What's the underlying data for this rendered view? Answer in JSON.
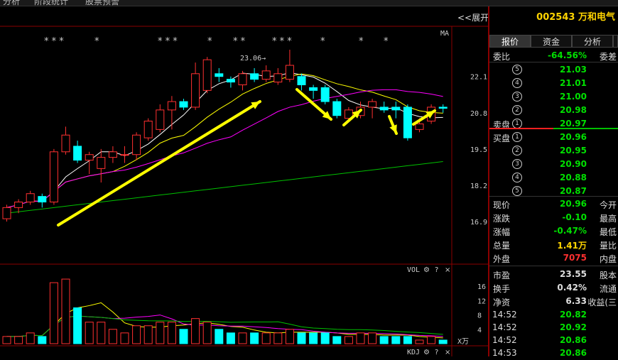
{
  "top_menu": [
    "分析",
    "阶段统计",
    "股票预警"
  ],
  "expand_label": "<<展开",
  "main_chart": {
    "ma_label": "MA",
    "star_groups": [
      "* * *",
      "*",
      "* * *",
      "*",
      "* *",
      "* * *",
      "*",
      "*",
      "*"
    ],
    "high_annotation": "23.06→",
    "price_ticks": [
      "22.1",
      "20.8",
      "19.5",
      "18.2",
      "16.9"
    ]
  },
  "volume_panel": {
    "label": "VOL",
    "ticks": [
      "16",
      "12",
      "8",
      "4"
    ],
    "unit": "X万"
  },
  "kdj_panel": {
    "label": "KDJ"
  },
  "stock": {
    "code": "002543",
    "name": "万和电气"
  },
  "tabs": [
    "报价",
    "资金",
    "分析"
  ],
  "quote": {
    "weibi_label": "委比",
    "weibi_value": "-64.56%",
    "weicha_label": "委差",
    "sell_label": "卖盘",
    "buy_label": "买盘",
    "sell_levels": [
      {
        "n": "5",
        "price": "21.03"
      },
      {
        "n": "4",
        "price": "21.01"
      },
      {
        "n": "3",
        "price": "21.00"
      },
      {
        "n": "2",
        "price": "20.98"
      },
      {
        "n": "1",
        "price": "20.97"
      }
    ],
    "buy_levels": [
      {
        "n": "1",
        "price": "20.96"
      },
      {
        "n": "2",
        "price": "20.95"
      },
      {
        "n": "3",
        "price": "20.90"
      },
      {
        "n": "4",
        "price": "20.88"
      },
      {
        "n": "5",
        "price": "20.87"
      }
    ]
  },
  "stats": [
    {
      "label": "现价",
      "value": "20.96",
      "label2": "今开",
      "color": "#00e000"
    },
    {
      "label": "涨跌",
      "value": "-0.10",
      "label2": "最高",
      "color": "#00e000"
    },
    {
      "label": "涨幅",
      "value": "-0.47%",
      "label2": "最低",
      "color": "#00e000"
    },
    {
      "label": "总量",
      "value": "1.41万",
      "label2": "量比",
      "color": "#ffd400"
    },
    {
      "label": "外盘",
      "value": "7075",
      "label2": "内盘",
      "color": "#ff3030"
    },
    {
      "label": "市盈",
      "value": "23.55",
      "label2": "股本",
      "color": "#dddddd"
    },
    {
      "label": "换手",
      "value": "0.42%",
      "label2": "流通",
      "color": "#dddddd"
    },
    {
      "label": "净资",
      "value": "6.33",
      "label2": "收益(三",
      "color": "#dddddd"
    }
  ],
  "ticks": [
    {
      "time": "14:52",
      "price": "20.82"
    },
    {
      "time": "14:52",
      "price": "20.92"
    },
    {
      "time": "14:52",
      "price": "20.86"
    },
    {
      "time": "14:53",
      "price": "20.86"
    }
  ],
  "colors": {
    "up": "#ff3030",
    "down": "#00ffff",
    "ma5": "#ffffff",
    "ma10": "#ffff00",
    "ma20": "#ff00ff",
    "ma60": "#00c000",
    "arrow": "#ffff00"
  },
  "chart_data": {
    "type": "candlestick",
    "y_range": [
      16.9,
      23.06
    ],
    "candles": [
      {
        "o": 17.0,
        "c": 17.4,
        "h": 17.5,
        "l": 16.9,
        "v": 2
      },
      {
        "o": 17.4,
        "c": 17.6,
        "h": 17.7,
        "l": 17.2,
        "v": 2
      },
      {
        "o": 17.6,
        "c": 17.9,
        "h": 18.0,
        "l": 17.5,
        "v": 3
      },
      {
        "o": 17.8,
        "c": 17.6,
        "h": 17.9,
        "l": 17.4,
        "v": 2
      },
      {
        "o": 17.6,
        "c": 19.4,
        "h": 19.5,
        "l": 17.5,
        "v": 17
      },
      {
        "o": 19.4,
        "c": 20.0,
        "h": 20.3,
        "l": 19.3,
        "v": 18
      },
      {
        "o": 19.6,
        "c": 19.1,
        "h": 19.8,
        "l": 19.0,
        "v": 10
      },
      {
        "o": 19.1,
        "c": 19.3,
        "h": 19.4,
        "l": 18.6,
        "v": 6
      },
      {
        "o": 18.8,
        "c": 19.2,
        "h": 19.5,
        "l": 18.3,
        "v": 6
      },
      {
        "o": 19.2,
        "c": 19.4,
        "h": 19.6,
        "l": 19.0,
        "v": 4
      },
      {
        "o": 19.3,
        "c": 19.3,
        "h": 19.6,
        "l": 19.0,
        "v": 3
      },
      {
        "o": 19.3,
        "c": 20.0,
        "h": 20.1,
        "l": 19.1,
        "v": 5
      },
      {
        "o": 19.9,
        "c": 20.5,
        "h": 20.6,
        "l": 19.8,
        "v": 5
      },
      {
        "o": 20.2,
        "c": 20.9,
        "h": 21.1,
        "l": 20.1,
        "v": 6
      },
      {
        "o": 20.9,
        "c": 21.2,
        "h": 21.4,
        "l": 20.2,
        "v": 6
      },
      {
        "o": 21.2,
        "c": 21.0,
        "h": 21.3,
        "l": 20.9,
        "v": 4
      },
      {
        "o": 21.0,
        "c": 22.2,
        "h": 22.6,
        "l": 20.9,
        "v": 7
      },
      {
        "o": 21.6,
        "c": 22.7,
        "h": 22.8,
        "l": 21.5,
        "v": 6
      },
      {
        "o": 22.2,
        "c": 22.1,
        "h": 22.4,
        "l": 21.9,
        "v": 4
      },
      {
        "o": 22.0,
        "c": 21.9,
        "h": 22.1,
        "l": 21.7,
        "v": 3
      },
      {
        "o": 21.8,
        "c": 22.2,
        "h": 22.3,
        "l": 21.6,
        "v": 3
      },
      {
        "o": 22.2,
        "c": 22.0,
        "h": 22.4,
        "l": 21.9,
        "v": 3
      },
      {
        "o": 22.0,
        "c": 22.3,
        "h": 22.5,
        "l": 21.9,
        "v": 3
      },
      {
        "o": 21.9,
        "c": 22.2,
        "h": 22.4,
        "l": 21.8,
        "v": 3
      },
      {
        "o": 22.0,
        "c": 22.5,
        "h": 23.06,
        "l": 21.9,
        "v": 4
      },
      {
        "o": 22.1,
        "c": 21.8,
        "h": 22.2,
        "l": 21.6,
        "v": 3
      },
      {
        "o": 21.7,
        "c": 21.6,
        "h": 21.8,
        "l": 21.3,
        "v": 3
      },
      {
        "o": 21.7,
        "c": 21.2,
        "h": 21.8,
        "l": 21.1,
        "v": 3
      },
      {
        "o": 21.2,
        "c": 20.7,
        "h": 21.3,
        "l": 20.6,
        "v": 2
      },
      {
        "o": 20.6,
        "c": 20.9,
        "h": 21.0,
        "l": 20.5,
        "v": 2
      },
      {
        "o": 20.7,
        "c": 21.0,
        "h": 21.2,
        "l": 20.6,
        "v": 3
      },
      {
        "o": 21.0,
        "c": 21.2,
        "h": 21.3,
        "l": 20.6,
        "v": 3
      },
      {
        "o": 21.0,
        "c": 20.9,
        "h": 21.2,
        "l": 20.8,
        "v": 2
      },
      {
        "o": 21.0,
        "c": 20.9,
        "h": 21.2,
        "l": 20.6,
        "v": 2
      },
      {
        "o": 21.0,
        "c": 19.9,
        "h": 21.1,
        "l": 19.8,
        "v": 2
      },
      {
        "o": 20.2,
        "c": 20.4,
        "h": 20.6,
        "l": 20.1,
        "v": 1
      },
      {
        "o": 20.5,
        "c": 21.0,
        "h": 21.1,
        "l": 20.4,
        "v": 2
      },
      {
        "o": 21.0,
        "c": 20.96,
        "h": 21.1,
        "l": 20.8,
        "v": 1
      }
    ]
  }
}
